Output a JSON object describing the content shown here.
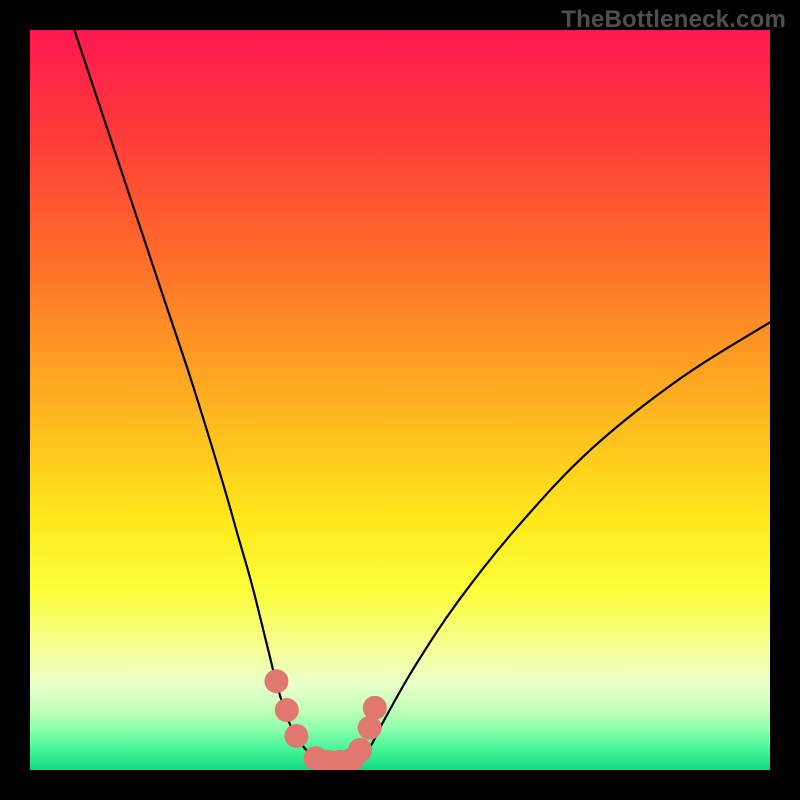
{
  "watermark": "TheBottleneck.com",
  "chart_data": {
    "type": "line",
    "title": "",
    "xlabel": "",
    "ylabel": "",
    "xlim": [
      0,
      100
    ],
    "ylim": [
      0,
      100
    ],
    "grid": false,
    "legend": false,
    "annotations": [],
    "series": [
      {
        "name": "curve-left",
        "x": [
          6,
          10,
          14,
          18,
          22,
          26,
          28,
          30,
          32,
          33.5,
          35,
          36,
          37.5,
          39
        ],
        "y": [
          100,
          88,
          76,
          64,
          52,
          39,
          32,
          25,
          17,
          11,
          6.5,
          4.5,
          2.5,
          1.2
        ]
      },
      {
        "name": "curve-right",
        "x": [
          44.5,
          46,
          48,
          52,
          58,
          66,
          76,
          88,
          100
        ],
        "y": [
          1.5,
          3.2,
          7,
          14,
          23,
          33,
          43.5,
          53,
          60.5
        ]
      },
      {
        "name": "floor",
        "x": [
          39,
          40.5,
          42,
          43,
          44.5
        ],
        "y": [
          1.2,
          0.9,
          0.9,
          1.0,
          1.5
        ]
      },
      {
        "name": "markers",
        "x": [
          33.3,
          34.7,
          36.0,
          38.6,
          40.3,
          41.9,
          43.5,
          44.6,
          45.9,
          46.6
        ],
        "y": [
          12.0,
          8.1,
          4.6,
          1.6,
          1.1,
          1.1,
          1.4,
          2.7,
          5.7,
          8.4
        ]
      }
    ],
    "background_gradient_stops": [
      {
        "pos": 0.0,
        "color": "#ff1850"
      },
      {
        "pos": 0.14,
        "color": "#ff3a3a"
      },
      {
        "pos": 0.3,
        "color": "#ff6a2a"
      },
      {
        "pos": 0.5,
        "color": "#ffb020"
      },
      {
        "pos": 0.66,
        "color": "#ffe81a"
      },
      {
        "pos": 0.76,
        "color": "#fbff3c"
      },
      {
        "pos": 0.845,
        "color": "#f4ffa0"
      },
      {
        "pos": 0.885,
        "color": "#e8ffca"
      },
      {
        "pos": 0.915,
        "color": "#c8ffb8"
      },
      {
        "pos": 0.945,
        "color": "#8cffac"
      },
      {
        "pos": 0.972,
        "color": "#45f59a"
      },
      {
        "pos": 1.0,
        "color": "#14d884"
      }
    ],
    "marker_style": {
      "shape": "circle",
      "radius_px": 12,
      "fill": "#e0786f"
    }
  }
}
